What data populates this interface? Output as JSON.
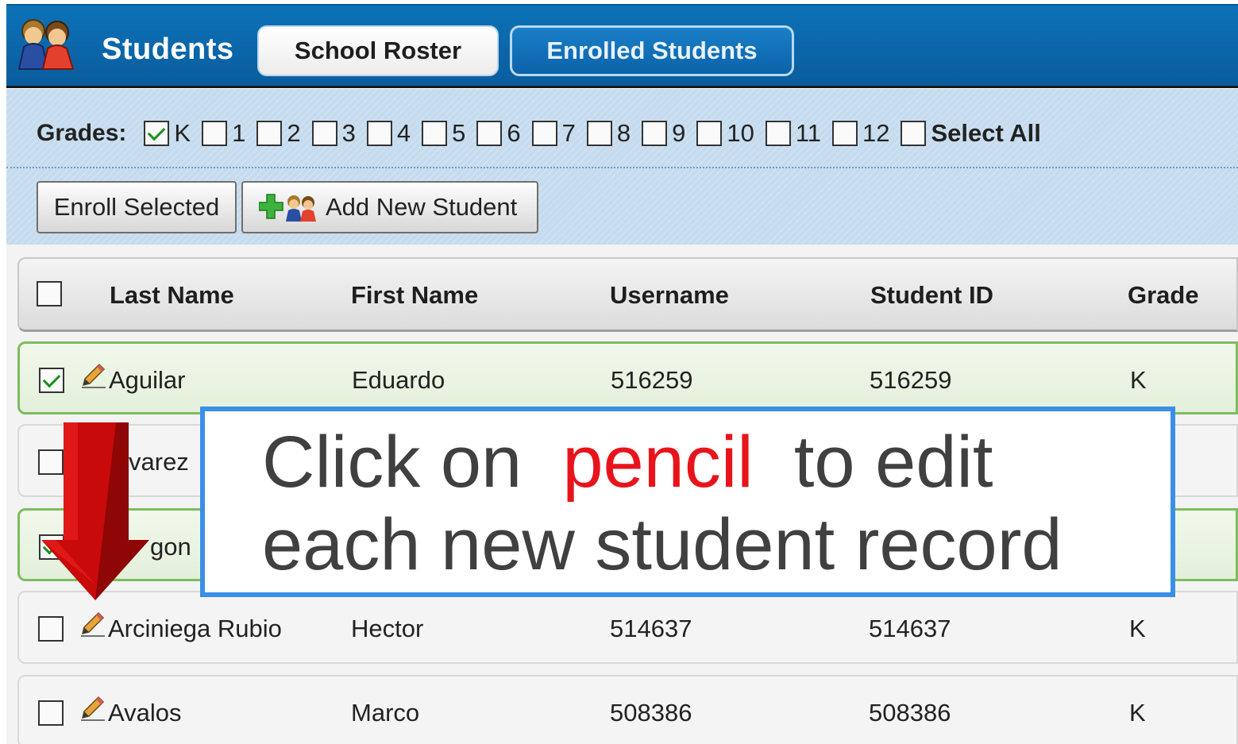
{
  "header": {
    "title": "Students",
    "tabs": [
      {
        "label": "School Roster",
        "active": true
      },
      {
        "label": "Enrolled Students",
        "active": false
      }
    ]
  },
  "filters": {
    "grades_label": "Grades:",
    "grades": [
      {
        "label": "K",
        "checked": true
      },
      {
        "label": "1",
        "checked": false
      },
      {
        "label": "2",
        "checked": false
      },
      {
        "label": "3",
        "checked": false
      },
      {
        "label": "4",
        "checked": false
      },
      {
        "label": "5",
        "checked": false
      },
      {
        "label": "6",
        "checked": false
      },
      {
        "label": "7",
        "checked": false
      },
      {
        "label": "8",
        "checked": false
      },
      {
        "label": "9",
        "checked": false
      },
      {
        "label": "10",
        "checked": false
      },
      {
        "label": "11",
        "checked": false
      },
      {
        "label": "12",
        "checked": false
      },
      {
        "label": "Select All",
        "checked": false
      }
    ],
    "buttons": {
      "enroll_selected": "Enroll Selected",
      "add_new_student": "Add New Student"
    }
  },
  "table": {
    "columns": [
      "Last Name",
      "First Name",
      "Username",
      "Student ID",
      "Grade"
    ],
    "rows": [
      {
        "last": "Aguilar",
        "first": "Eduardo",
        "username": "516259",
        "id": "516259",
        "grade": "K",
        "checked": true
      },
      {
        "last": "varez",
        "first": "",
        "username": "",
        "id": "",
        "grade": "",
        "checked": false
      },
      {
        "last": "gon",
        "first": "",
        "username": "",
        "id": "",
        "grade": "",
        "checked": true
      },
      {
        "last": "Arciniega Rubio",
        "first": "Hector",
        "username": "514637",
        "id": "514637",
        "grade": "K",
        "checked": false
      },
      {
        "last": "Avalos",
        "first": "Marco",
        "username": "508386",
        "id": "508386",
        "grade": "K",
        "checked": false
      }
    ]
  },
  "callout": {
    "line1_pre": "Click on",
    "line1_highlight": "pencil",
    "line1_post": "to edit",
    "line2": "each new student record"
  },
  "colors": {
    "header_blue": "#0b66ab",
    "filter_panel": "#c6dcee",
    "selected_row_border": "#7cbd5e",
    "callout_border": "#3a8fe8",
    "highlight_red": "#e8141b",
    "arrow_red": "#c80a0a"
  }
}
